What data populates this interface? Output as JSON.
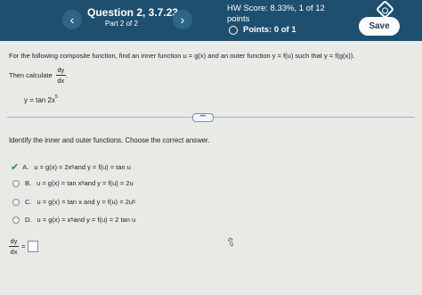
{
  "header": {
    "prev_label": "‹",
    "next_label": "›",
    "question_title": "Question 2, 3.7.23",
    "question_part": "Part 2 of 2",
    "hw_score": "HW Score: 8.33%, 1 of 12",
    "hw_points_label": "points",
    "points": "Points: 0 of 1",
    "save_label": "Save",
    "settings_icon": "gear-icon"
  },
  "problem": {
    "statement": "For the following composite function, find an inner function u = g(x) and an outer function y = f(u) such that y = f(g(x)).",
    "then_calculate": "Then calculate",
    "dy": "dy",
    "dx": "dx",
    "period": ".",
    "function_base": "y = tan 2x",
    "function_exp": "5",
    "more_label": "•••"
  },
  "question": {
    "instructions": "Identify the inner and outer functions. Choose the correct answer.",
    "options": [
      {
        "letter": "A.",
        "pre": "u = g(x) = 2x",
        "exp": "5",
        "post": " and y = f(u) = tan u",
        "selected": true
      },
      {
        "letter": "B.",
        "pre": "u = g(x) = tan x",
        "exp": "5",
        "post": " and y = f(u) = 2u",
        "selected": false
      },
      {
        "letter": "C.",
        "pre": "u = g(x) = tan x and y = f(u) = 2u",
        "exp": "5",
        "post": "",
        "selected": false
      },
      {
        "letter": "D.",
        "pre": "u = g(x) = x",
        "exp": "5",
        "post": " and y = f(u) = 2 tan u",
        "selected": false
      }
    ]
  },
  "answer": {
    "dy": "dy",
    "dx": "dx",
    "equals": "="
  }
}
